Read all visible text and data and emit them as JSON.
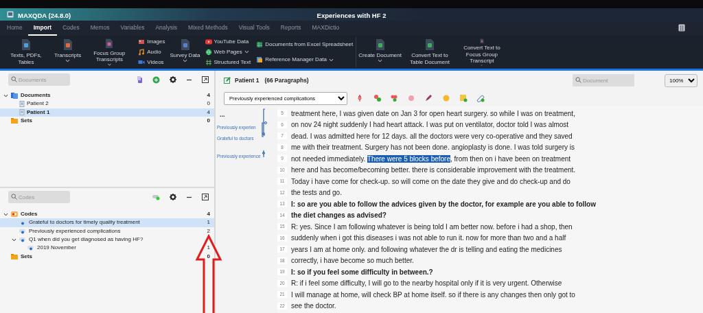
{
  "app": {
    "title": "MAXQDA (24.8.0)",
    "project": "Experiences with HF 2"
  },
  "tabs": [
    {
      "label": "Home",
      "selected": false
    },
    {
      "label": "Import",
      "selected": true
    },
    {
      "label": "Codes",
      "selected": false
    },
    {
      "label": "Memos",
      "selected": false
    },
    {
      "label": "Variables",
      "selected": false
    },
    {
      "label": "Analysis",
      "selected": false
    },
    {
      "label": "Mixed Methods",
      "selected": false
    },
    {
      "label": "Visual Tools",
      "selected": false
    },
    {
      "label": "Reports",
      "selected": false
    },
    {
      "label": "MAXDictio",
      "selected": false
    }
  ],
  "ribbon": [
    {
      "kind": "large",
      "label": "Texts, PDFs, Tables",
      "dropdown": false
    },
    {
      "kind": "large",
      "label": "Transcripts",
      "dropdown": true
    },
    {
      "kind": "large",
      "label": "Focus Group Transcripts",
      "dropdown": true
    },
    {
      "kind": "stack",
      "items": [
        {
          "label": "Images",
          "dropdown": false
        },
        {
          "label": "Audio",
          "dropdown": false
        },
        {
          "label": "Videos",
          "dropdown": false
        }
      ]
    },
    {
      "kind": "large",
      "label": "Survey Data",
      "dropdown": true
    },
    {
      "kind": "stack",
      "items": [
        {
          "label": "YouTube Data",
          "dropdown": false
        },
        {
          "label": "Web Pages",
          "dropdown": true
        },
        {
          "label": "Structured Text",
          "dropdown": false
        }
      ]
    },
    {
      "kind": "stack",
      "items": [
        {
          "label": "Documents from Excel Spreadsheet",
          "dropdown": false
        },
        {
          "label": "Reference Manager Data",
          "dropdown": true
        }
      ]
    },
    {
      "kind": "large",
      "label": "Create Document",
      "dropdown": true
    },
    {
      "kind": "large",
      "label": "Convert Text to Table Document",
      "dropdown": false
    },
    {
      "kind": "large",
      "label": "Convert Text to Focus Group Transcript",
      "dropdown": true
    }
  ],
  "documents_pane": {
    "search": {
      "placeholder": "Documents"
    },
    "tree": [
      {
        "kind": "folder",
        "label": "Documents",
        "count": "4",
        "expanded": true,
        "children": [
          {
            "kind": "document",
            "label": "Patient 2",
            "count": "0",
            "selected": false,
            "opened": false
          },
          {
            "kind": "document",
            "label": "Patient 1",
            "count": "4",
            "selected": true,
            "opened": true
          }
        ]
      },
      {
        "kind": "sets",
        "label": "Sets",
        "count": "0"
      }
    ]
  },
  "codes_pane": {
    "search": {
      "placeholder": "Codes"
    },
    "tree": [
      {
        "kind": "code-root",
        "label": "Codes",
        "count": "4",
        "expanded": true,
        "children": [
          {
            "kind": "code",
            "label": "Grateful to doctors for timely quality treatment",
            "count": "1",
            "selected": true
          },
          {
            "kind": "code",
            "label": "Previously experienced complications",
            "count": "2",
            "selected": false
          },
          {
            "kind": "code",
            "label": "Q1 when did you get diagnosed as having HF?",
            "expanded": true,
            "selected": false,
            "children": [
              {
                "kind": "code",
                "label": "2019 November",
                "count": "1",
                "selected": false
              }
            ]
          }
        ]
      },
      {
        "kind": "sets",
        "label": "Sets",
        "count": "0"
      }
    ]
  },
  "document_view": {
    "title": "Patient 1",
    "paragraphs": "(66 Paragraphs)",
    "search": {
      "placeholder": "Document"
    },
    "zoom": "100%",
    "code_select": "Previously experienced complications",
    "more": "...",
    "codings": [
      {
        "label": "Previously experien"
      },
      {
        "label": "Grateful to doctors"
      },
      {
        "label": "Previously experience"
      }
    ],
    "lines": [
      {
        "number": "5",
        "bold": false,
        "segments": [
          {
            "text": "treatment here, I was given date on Jan 3 for open heart surgery. so while I was on treatment,",
            "selected": false
          }
        ]
      },
      {
        "number": "6",
        "bold": false,
        "segments": [
          {
            "text": "on nov 24 night suddenly I had heart attack. I was put on ventilator, doctor told I was almost",
            "selected": false
          }
        ]
      },
      {
        "number": "7",
        "bold": false,
        "segments": [
          {
            "text": "dead. I was admitted here for 12 days. all the doctors were very co-operative and they saved",
            "selected": false
          }
        ]
      },
      {
        "number": "8",
        "bold": false,
        "segments": [
          {
            "text": "me with their treatment. Surgery has not been done. angioplasty is done. I was told surgery is",
            "selected": false
          }
        ]
      },
      {
        "number": "9",
        "bold": false,
        "segments": [
          {
            "text": "not needed immediately. ",
            "selected": false
          },
          {
            "text": "There were 5 blocks before",
            "selected": true
          },
          {
            "text": ", from then on i have been on treatment",
            "selected": false
          }
        ]
      },
      {
        "number": "10",
        "bold": false,
        "segments": [
          {
            "text": "here and has become/becoming better. there is considerable improvement with the treatment.",
            "selected": false
          }
        ]
      },
      {
        "number": "11",
        "bold": false,
        "segments": [
          {
            "text": "Today i have come for check-up. so will come on the date they give and do check-up and do",
            "selected": false
          }
        ]
      },
      {
        "number": "12",
        "bold": false,
        "segments": [
          {
            "text": "the tests and go.",
            "selected": false
          }
        ]
      },
      {
        "number": "13",
        "bold": true,
        "segments": [
          {
            "text": "I: so are you able to follow the advices given by the doctor, for example are you able to follow",
            "selected": false
          }
        ]
      },
      {
        "number": "14",
        "bold": true,
        "segments": [
          {
            "text": "the diet changes as advised?",
            "selected": false
          }
        ]
      },
      {
        "number": "15",
        "bold": false,
        "segments": [
          {
            "text": "R: yes. Since I am following whatever is being told I am better now. before i had a shop, then",
            "selected": false
          }
        ]
      },
      {
        "number": "16",
        "bold": false,
        "segments": [
          {
            "text": "suddenly when i got this diseases i was not able to run it. now for more than two and a half",
            "selected": false
          }
        ]
      },
      {
        "number": "17",
        "bold": false,
        "segments": [
          {
            "text": "years I am at home only. and following whatever the dr is telling and eating the medicines",
            "selected": false
          }
        ]
      },
      {
        "number": "18",
        "bold": false,
        "segments": [
          {
            "text": "correctly, i have become so much better.",
            "selected": false
          }
        ]
      },
      {
        "number": "19",
        "bold": true,
        "segments": [
          {
            "text": "I: so if you feel some difficulty in between.?",
            "selected": false
          }
        ]
      },
      {
        "number": "20",
        "bold": false,
        "segments": [
          {
            "text": "R: if i feel some difficulty, I will go to the nearby hospital only if it is very urgent. Otherwise",
            "selected": false
          }
        ]
      },
      {
        "number": "21",
        "bold": false,
        "segments": [
          {
            "text": "I will manage at home, will check BP at home itself. so if there is any changes then only got to",
            "selected": false
          }
        ]
      },
      {
        "number": "22",
        "bold": false,
        "segments": [
          {
            "text": "see the doctor.",
            "selected": false
          }
        ]
      }
    ]
  }
}
